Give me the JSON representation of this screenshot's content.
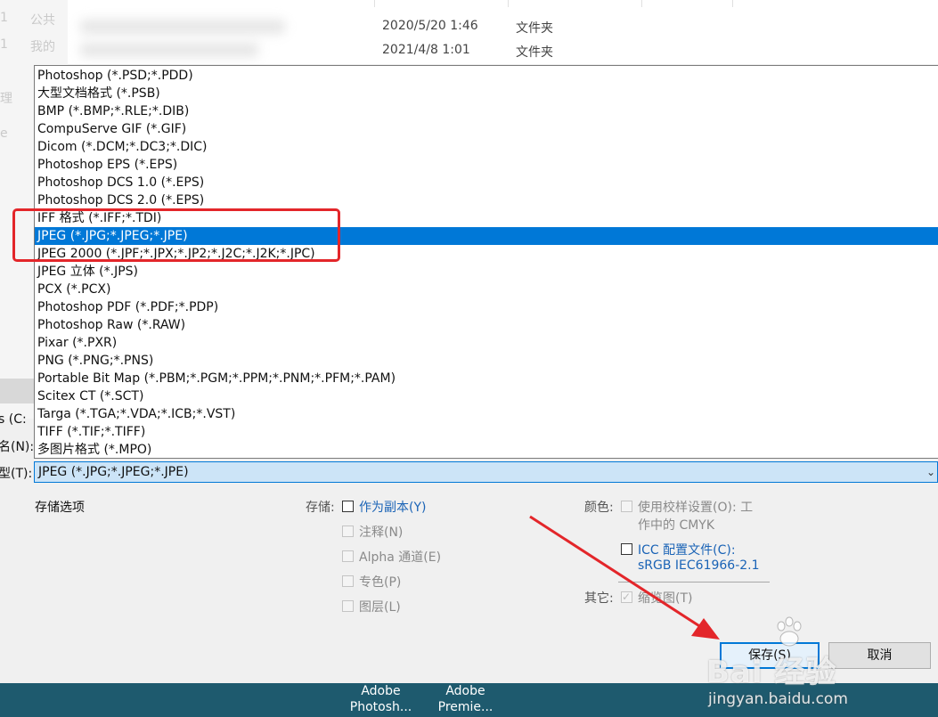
{
  "explorer": {
    "rows": [
      {
        "date": "2020/5/20 1:46",
        "type": "文件夹"
      },
      {
        "date": "2021/4/8 1:01",
        "type": "文件夹"
      }
    ],
    "nav_fragments": [
      "1",
      "公共",
      "1",
      "我的",
      "理",
      "e"
    ]
  },
  "format_list": {
    "items": [
      "Photoshop (*.PSD;*.PDD)",
      "大型文档格式 (*.PSB)",
      "BMP (*.BMP;*.RLE;*.DIB)",
      "CompuServe GIF (*.GIF)",
      "Dicom (*.DCM;*.DC3;*.DIC)",
      "Photoshop EPS (*.EPS)",
      "Photoshop DCS 1.0 (*.EPS)",
      "Photoshop DCS 2.0 (*.EPS)",
      "IFF 格式 (*.IFF;*.TDI)",
      "JPEG (*.JPG;*.JPEG;*.JPE)",
      "JPEG 2000 (*.JPF;*.JPX;*.JP2;*.J2C;*.J2K;*.JPC)",
      "JPEG 立体 (*.JPS)",
      "PCX (*.PCX)",
      "Photoshop PDF (*.PDF;*.PDP)",
      "Photoshop Raw (*.RAW)",
      "Pixar (*.PXR)",
      "PNG (*.PNG;*.PNS)",
      "Portable Bit Map (*.PBM;*.PGM;*.PPM;*.PNM;*.PFM;*.PAM)",
      "Scitex CT (*.SCT)",
      "Targa (*.TGA;*.VDA;*.ICB;*.VST)",
      "TIFF (*.TIF;*.TIFF)",
      "多图片格式 (*.MPO)"
    ],
    "selected_index": 9
  },
  "side_labels": {
    "drive_fragment": "s (C:",
    "filename_label": "名(N):",
    "type_label": "型(T):"
  },
  "save_type": {
    "value": "JPEG (*.JPG;*.JPEG;*.JPE)",
    "chevron": "⌄"
  },
  "options": {
    "section_title": "存储选项",
    "storage_label": "存储:",
    "as_copy": "作为副本(Y)",
    "annotations": "注释(N)",
    "alpha": "Alpha 通道(E)",
    "spot": "专色(P)",
    "layers": "图层(L)",
    "color_label": "颜色:",
    "proof_line1": "使用校样设置(O):  工",
    "proof_line2": "作中的 CMYK",
    "icc_line1": "ICC 配置文件(C):",
    "icc_line2": "sRGB IEC61966-2.1",
    "other_label": "其它:",
    "thumbnail": "缩览图(T)"
  },
  "buttons": {
    "save": "保存(S)",
    "cancel": "取消"
  },
  "taskbar": {
    "items": [
      {
        "line1": "Adobe",
        "line2": "Photosh..."
      },
      {
        "line1": "Adobe",
        "line2": "Premie..."
      }
    ]
  },
  "watermark": {
    "brand": "Bai 经验",
    "url": "jingyan.baidu.com"
  },
  "colors": {
    "selection": "#0078d7",
    "highlight_box": "#e3262a",
    "arrow": "#e3262a",
    "link": "#1a63b6",
    "taskbar": "#1e5a6e"
  }
}
